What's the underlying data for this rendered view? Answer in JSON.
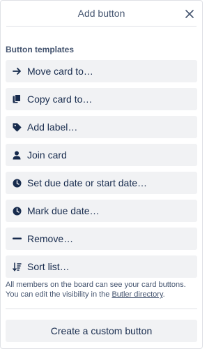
{
  "header": {
    "title": "Add button"
  },
  "section_title": "Button templates",
  "buttons": [
    {
      "label": "Move card to…",
      "icon": "arrow-right-icon"
    },
    {
      "label": "Copy card to…",
      "icon": "copy-icon"
    },
    {
      "label": "Add label…",
      "icon": "label-icon"
    },
    {
      "label": "Join card",
      "icon": "member-icon"
    },
    {
      "label": "Set due date or start date…",
      "icon": "clock-icon"
    },
    {
      "label": "Mark due date…",
      "icon": "clock-icon"
    },
    {
      "label": "Remove…",
      "icon": "minus-icon"
    },
    {
      "label": "Sort list…",
      "icon": "sort-icon"
    }
  ],
  "note": {
    "text_before": "All members on the board can see your card buttons. You can edit the visibility in the ",
    "link": "Butler directory",
    "text_after": "."
  },
  "custom_button": {
    "label": "Create a custom button"
  },
  "colors": {
    "button_bg": "#f1f2f4",
    "text": "#172b4d",
    "muted": "#44546f",
    "border": "#dfe1e6"
  }
}
